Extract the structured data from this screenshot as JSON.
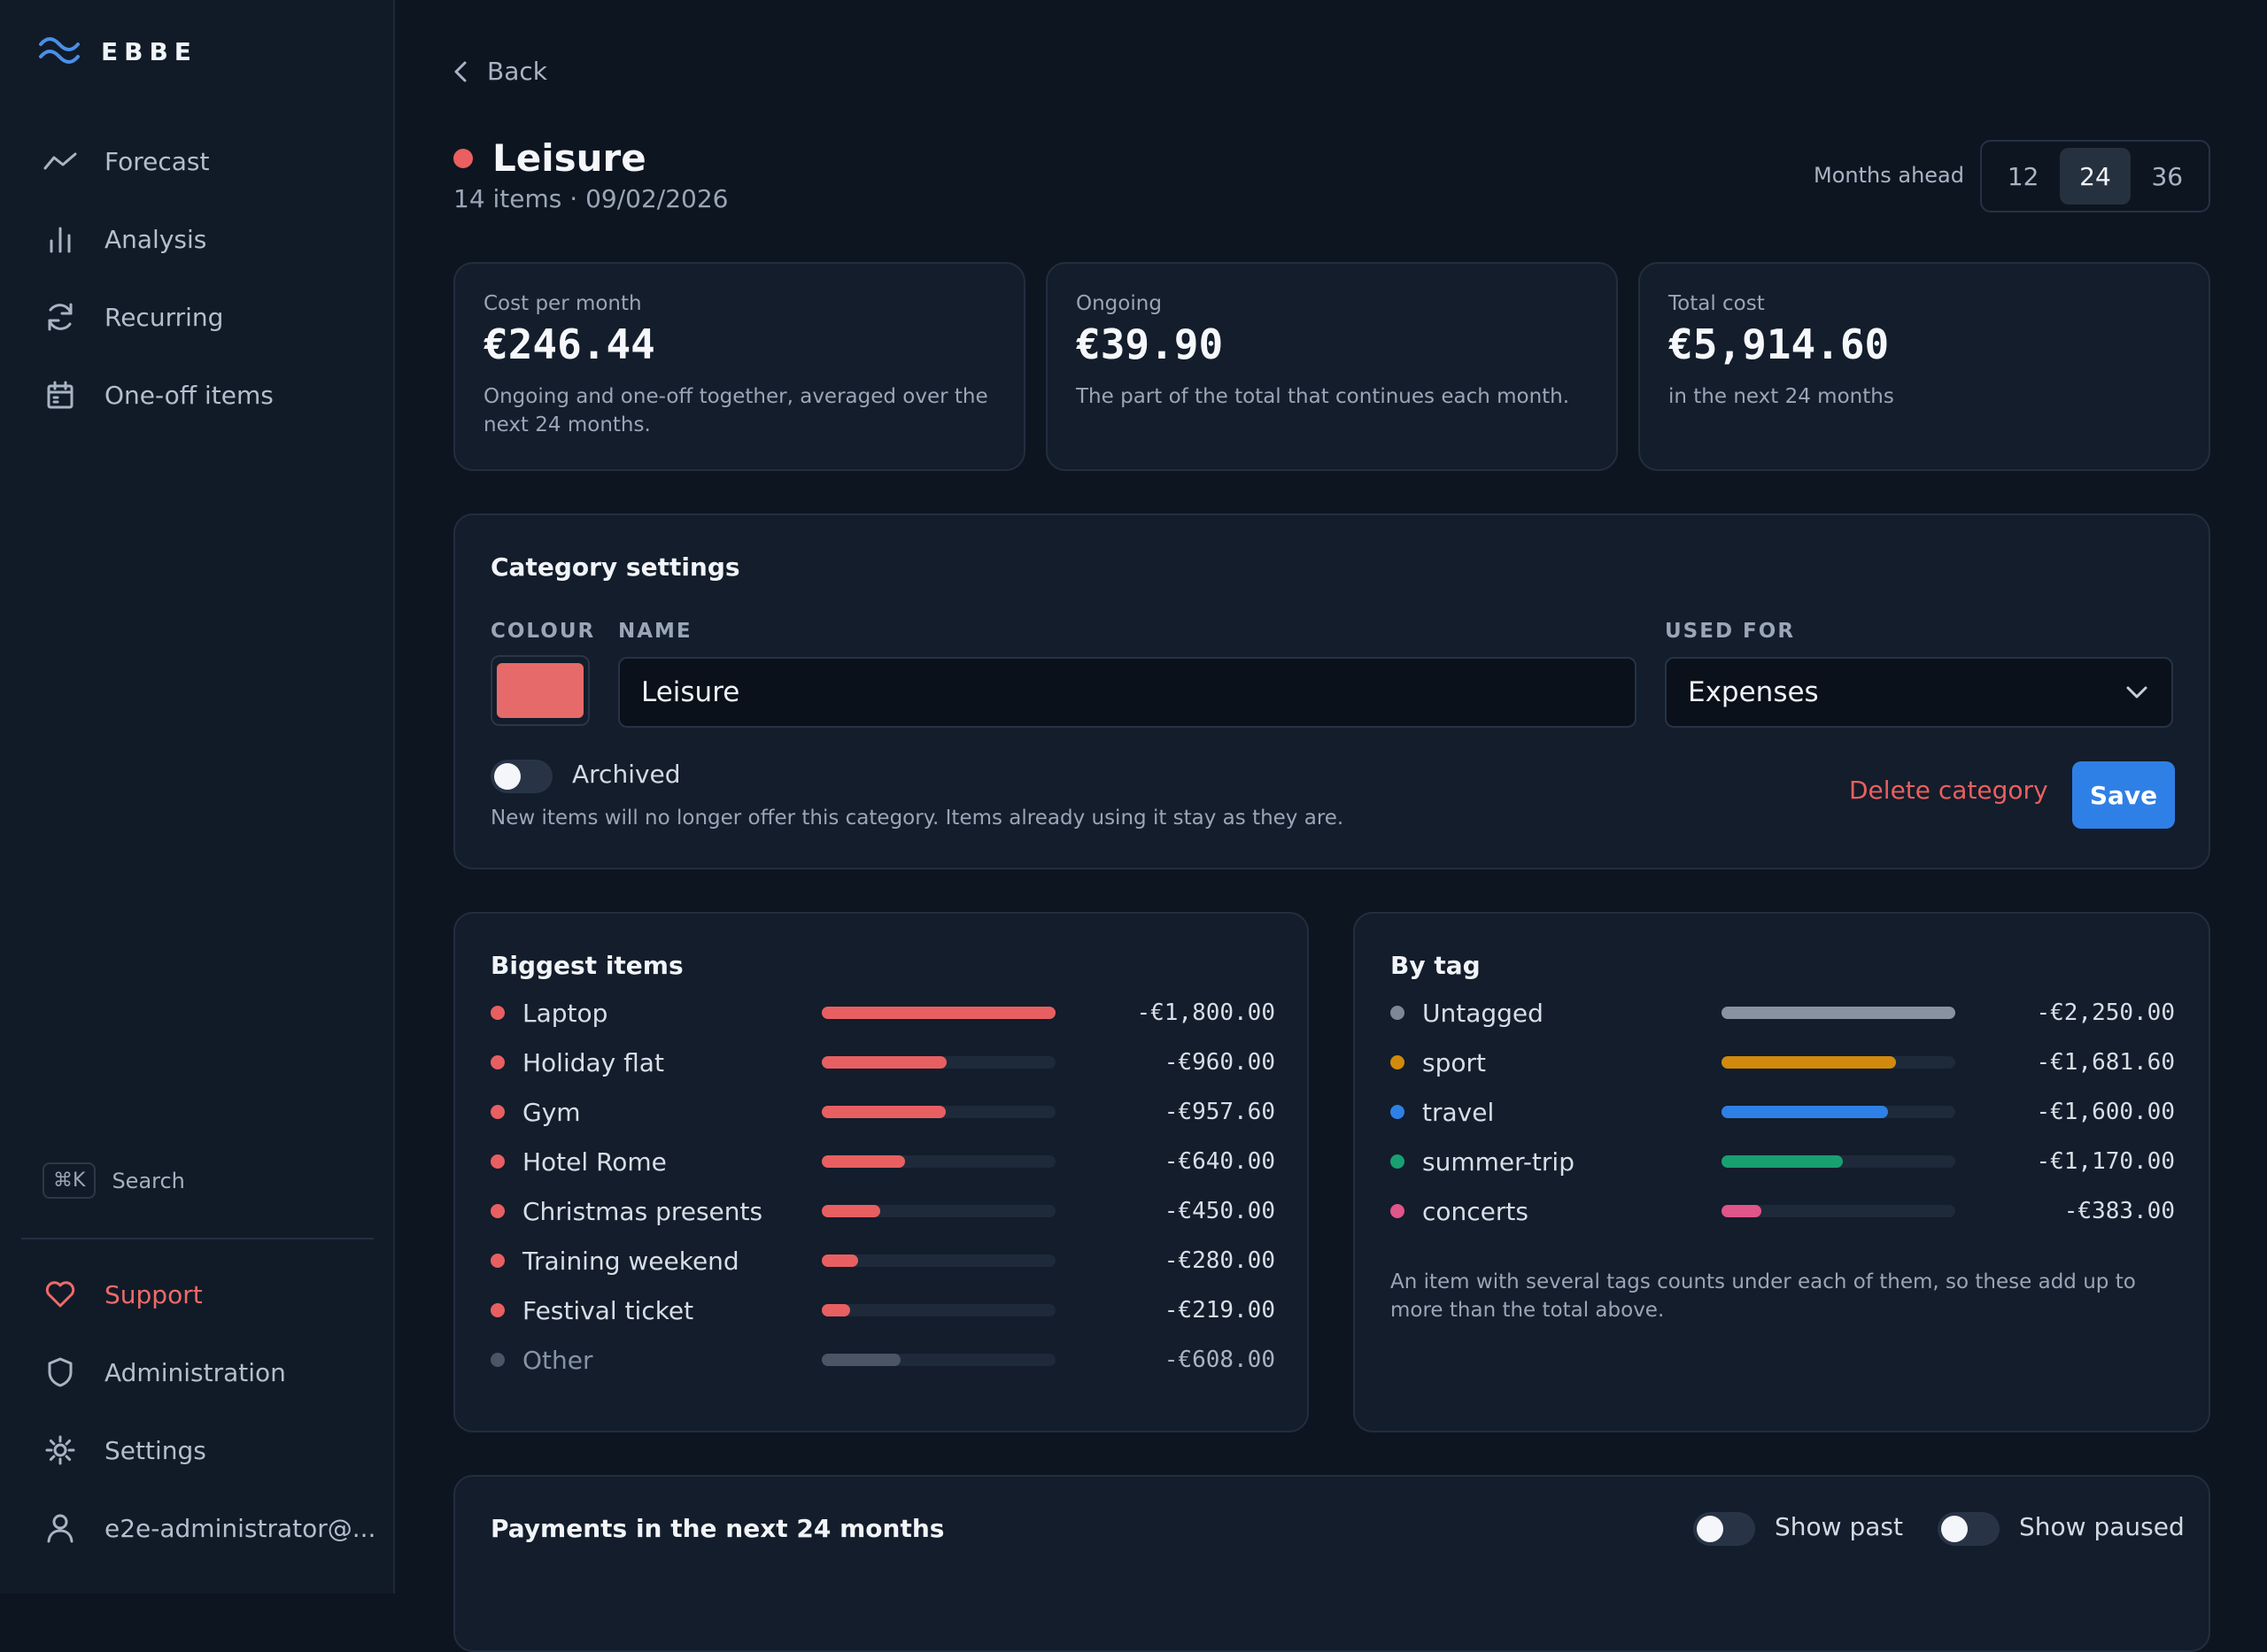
{
  "app": {
    "name": "EBBE"
  },
  "sidebar": {
    "nav": [
      {
        "label": "Forecast"
      },
      {
        "label": "Analysis"
      },
      {
        "label": "Recurring"
      },
      {
        "label": "One-off items"
      }
    ],
    "search": {
      "shortcut": "⌘K",
      "label": "Search"
    },
    "bottom": [
      {
        "label": "Support"
      },
      {
        "label": "Administration"
      },
      {
        "label": "Settings"
      },
      {
        "label": "e2e-administrator@..."
      }
    ]
  },
  "header": {
    "back_label": "Back",
    "title": "Leisure",
    "title_color": "#ea5f60",
    "subtitle": "14 items · 09/02/2026",
    "months_label": "Months ahead",
    "months_options": [
      "12",
      "24",
      "36"
    ],
    "months_selected": "24"
  },
  "kpis": [
    {
      "label": "Cost per month",
      "value": "€246.44",
      "desc": "Ongoing and one-off together, averaged over the next 24 months."
    },
    {
      "label": "Ongoing",
      "value": "€39.90",
      "desc": "The part of the total that continues each month."
    },
    {
      "label": "Total cost",
      "value": "€5,914.60",
      "desc": "in the next 24 months"
    }
  ],
  "settings": {
    "title": "Category settings",
    "colour_label": "COLOUR",
    "colour_value": "#e66a6a",
    "name_label": "NAME",
    "name_value": "Leisure",
    "used_for_label": "USED FOR",
    "used_for_value": "Expenses",
    "archived_label": "Archived",
    "archived_on": false,
    "hint": "New items will no longer offer this category. Items already using it stay as they are.",
    "delete_label": "Delete category",
    "save_label": "Save"
  },
  "biggest": {
    "title": "Biggest items",
    "items": [
      {
        "label": "Laptop",
        "amount": "-€1,800.00",
        "share": 1.0,
        "color": "#e85f62"
      },
      {
        "label": "Holiday flat",
        "amount": "-€960.00",
        "share": 0.533,
        "color": "#e85f62"
      },
      {
        "label": "Gym",
        "amount": "-€957.60",
        "share": 0.532,
        "color": "#e85f62"
      },
      {
        "label": "Hotel Rome",
        "amount": "-€640.00",
        "share": 0.356,
        "color": "#e85f62"
      },
      {
        "label": "Christmas presents",
        "amount": "-€450.00",
        "share": 0.25,
        "color": "#e85f62"
      },
      {
        "label": "Training weekend",
        "amount": "-€280.00",
        "share": 0.156,
        "color": "#e85f62"
      },
      {
        "label": "Festival ticket",
        "amount": "-€219.00",
        "share": 0.122,
        "color": "#e85f62"
      },
      {
        "label": "Other",
        "amount": "-€608.00",
        "share": 0.338,
        "color": "#4a5566",
        "muted": true
      }
    ]
  },
  "by_tag": {
    "title": "By tag",
    "items": [
      {
        "label": "Untagged",
        "amount": "-€2,250.00",
        "share": 1.0,
        "color": "#8892a0",
        "dot": "#7d8795"
      },
      {
        "label": "sport",
        "amount": "-€1,681.60",
        "share": 0.747,
        "color": "#d18a0c",
        "dot": "#d18a0c"
      },
      {
        "label": "travel",
        "amount": "-€1,600.00",
        "share": 0.711,
        "color": "#2f80e6",
        "dot": "#2f80e6"
      },
      {
        "label": "summer-trip",
        "amount": "-€1,170.00",
        "share": 0.52,
        "color": "#18a071",
        "dot": "#18a071"
      },
      {
        "label": "concerts",
        "amount": "-€383.00",
        "share": 0.17,
        "color": "#e0558a",
        "dot": "#e0558a"
      }
    ],
    "note": "An item with several tags counts under each of them, so these add up to more than the total above."
  },
  "payments": {
    "title": "Payments in the next 24 months",
    "show_past_label": "Show past",
    "show_paused_label": "Show paused"
  }
}
